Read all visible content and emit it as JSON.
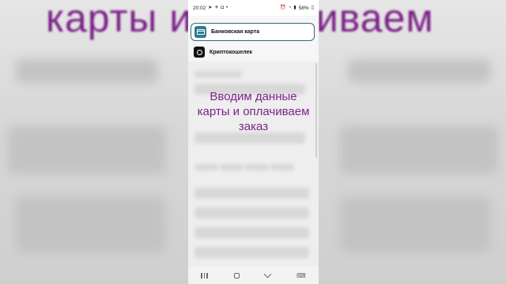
{
  "backdrop": {
    "title": "карты и оплачиваем"
  },
  "status_bar": {
    "time": "20:02",
    "battery": "58%"
  },
  "payment_options": [
    {
      "label": "Банковская карта",
      "icon": "bank-card-icon",
      "selected": true
    },
    {
      "label": "Криптокошелек",
      "icon": "crypto-wallet-icon",
      "selected": false
    }
  ],
  "overlay_caption": "Вводим данные карты и оплачиваем заказ",
  "colors": {
    "caption": "#7d2389",
    "accent": "#2e7d8f"
  }
}
